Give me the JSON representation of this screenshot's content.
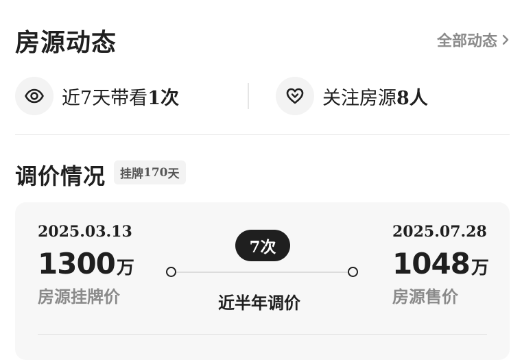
{
  "header": {
    "title": "房源动态",
    "all_link": "全部动态"
  },
  "stats": {
    "viewing": {
      "prefix": "近",
      "days": "7",
      "mid": "天带看",
      "count": "1次",
      "icon": "eye-icon"
    },
    "follow": {
      "prefix": "关注房源",
      "count": "8人",
      "icon": "heart-icon"
    }
  },
  "price_section": {
    "title": "调价情况",
    "badge_prefix": "挂牌",
    "badge_days": "170",
    "badge_suffix": "天",
    "start": {
      "date": "2025.03.13",
      "price": "1300",
      "unit": "万",
      "label": "房源挂牌价"
    },
    "end": {
      "date": "2025.07.28",
      "price": "1048",
      "unit": "万",
      "label": "房源售价"
    },
    "adjust_count": "7次",
    "adjust_caption": "近半年调价"
  }
}
